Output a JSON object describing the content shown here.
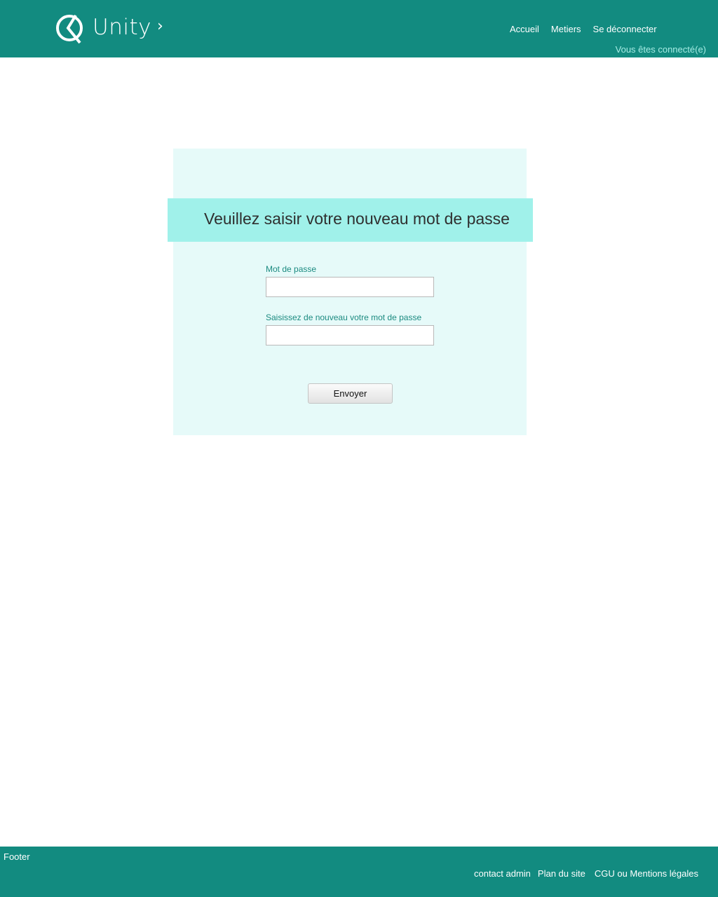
{
  "header": {
    "logo_text": "Unity",
    "logo_chevron": "›",
    "nav": [
      {
        "label": "Accueil"
      },
      {
        "label": "Metiers"
      },
      {
        "label": "Se déconnecter"
      }
    ],
    "connected_text": "Vous êtes connecté(e)"
  },
  "form": {
    "title": "Veuillez saisir votre nouveau mot de passe",
    "password_label": "Mot de passe",
    "password_value": "",
    "confirm_label": "Saisissez de nouveau votre mot de passe",
    "confirm_value": "",
    "submit_label": "Envoyer"
  },
  "footer": {
    "label": "Footer",
    "links": [
      {
        "label": "contact admin"
      },
      {
        "label": "Plan du site"
      },
      {
        "label": "CGU ou Mentions légales"
      }
    ]
  },
  "colors": {
    "header_bg": "#128b80",
    "panel_bg": "#e6faf9",
    "title_band_bg": "#a0f1ea",
    "label_text": "#1b8a80",
    "connected_text": "#a6ece4"
  },
  "icons": {
    "logo": "unity-logo-icon"
  }
}
